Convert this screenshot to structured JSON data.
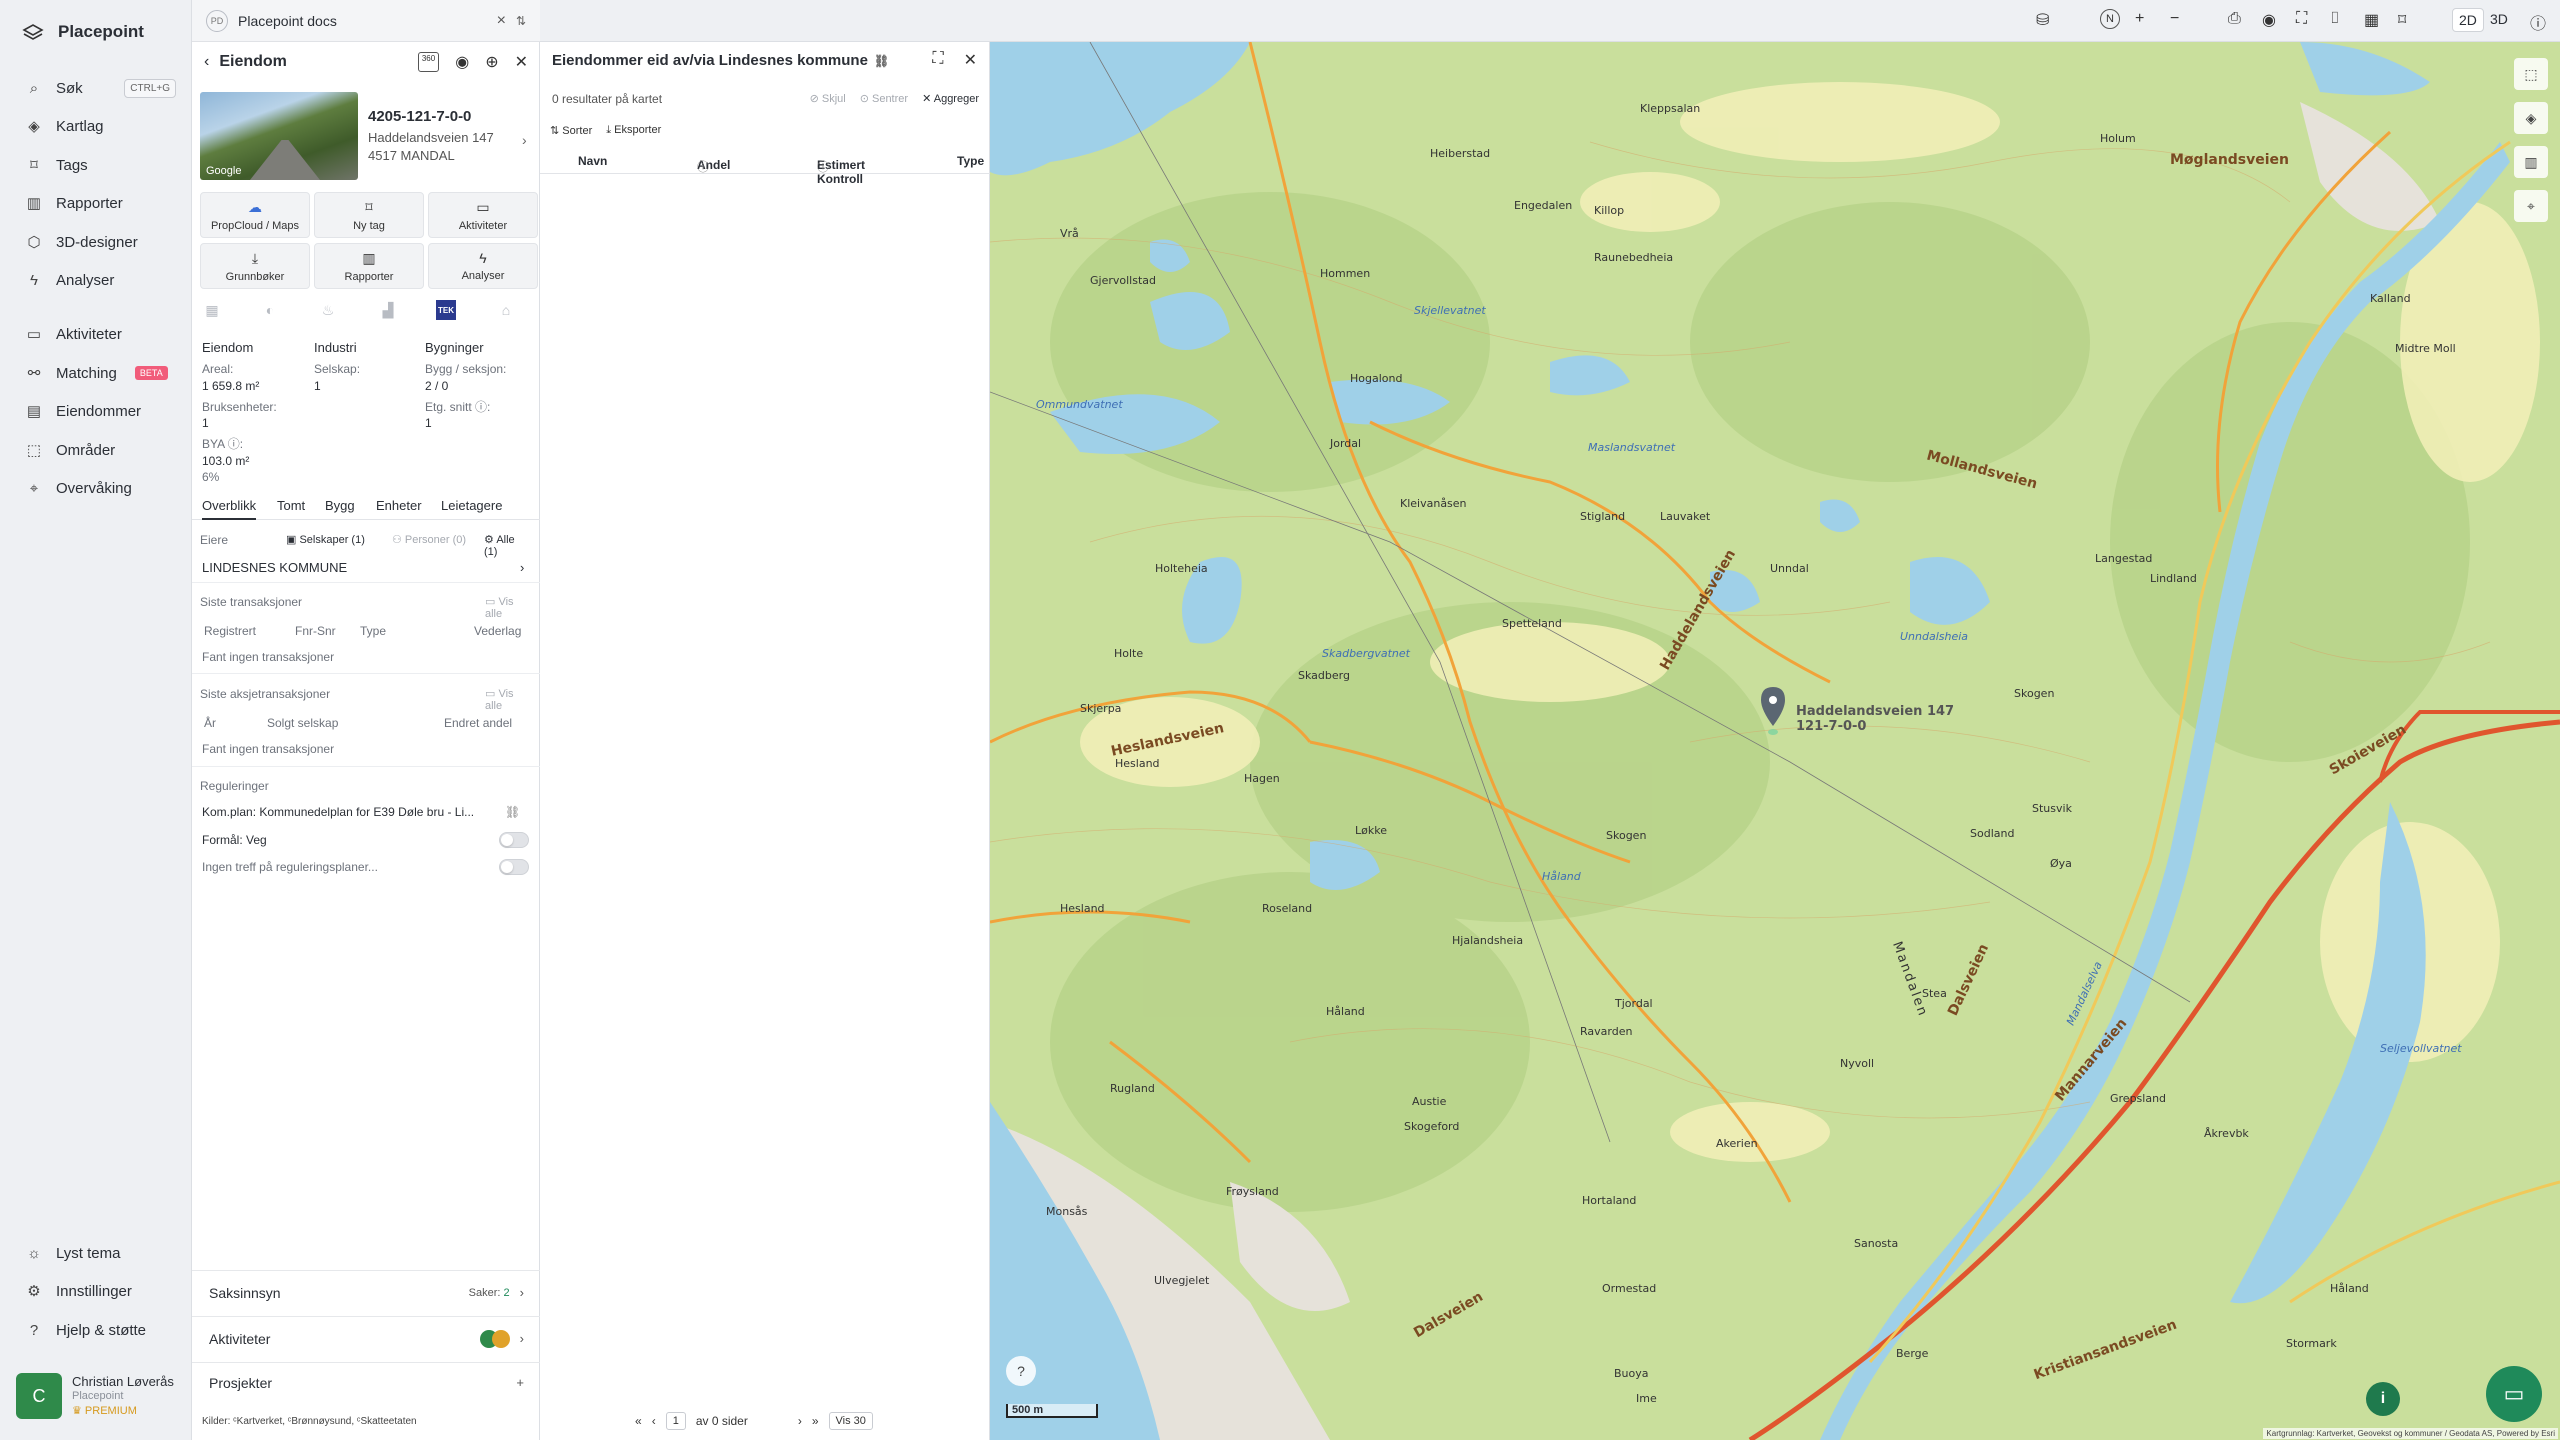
{
  "app": {
    "name": "Placepoint"
  },
  "nav": {
    "items": [
      {
        "label": "Søk",
        "shortcut": "CTRL+G"
      },
      {
        "label": "Kartlag"
      },
      {
        "label": "Tags"
      },
      {
        "label": "Rapporter"
      },
      {
        "label": "3D-designer"
      },
      {
        "label": "Analyser"
      },
      {
        "label": "Aktiviteter"
      },
      {
        "label": "Matching",
        "badge": "BETA"
      },
      {
        "label": "Eiendommer"
      },
      {
        "label": "Områder"
      },
      {
        "label": "Overvåking"
      }
    ],
    "bottom": [
      {
        "label": "Lyst tema"
      },
      {
        "label": "Innstillinger"
      },
      {
        "label": "Hjelp & støtte"
      }
    ],
    "user": {
      "initial": "C",
      "name": "Christian Løverås",
      "org": "Placepoint",
      "plan": "PREMIUM"
    }
  },
  "docs": {
    "badge": "PD",
    "title": "Placepoint docs"
  },
  "property": {
    "header": "Eiendom",
    "badge360": "360",
    "photo_credit": "Google",
    "id": "4205-121-7-0-0",
    "address": "Haddelandsveien 147",
    "postal": "4517 MANDAL",
    "actions": [
      {
        "label": "PropCloud / Maps",
        "icon": "cloud-icon"
      },
      {
        "label": "Ny tag",
        "icon": "bookmark-icon"
      },
      {
        "label": "Aktiviteter",
        "icon": "chat-icon"
      },
      {
        "label": "Grunnbøker",
        "icon": "download-icon"
      },
      {
        "label": "Rapporter",
        "icon": "chart-icon"
      },
      {
        "label": "Analyser",
        "icon": "bolt-icon"
      }
    ],
    "tek_label": "TEK",
    "stats": {
      "col1_header": "Eiendom",
      "col2_header": "Industri",
      "col3_header": "Bygninger",
      "areal_label": "Areal:",
      "areal_value": "1 659.8 m²",
      "bruksenheter_label": "Bruksenheter:",
      "bruksenheter_value": "1",
      "bya_label": "BYA ⓘ:",
      "bya_value": "103.0 m²",
      "bya_pct": "6%",
      "selskap_label": "Selskap:",
      "selskap_value": "1",
      "bygg_label": "Bygg / seksjon:",
      "bygg_value": "2 / 0",
      "etg_label": "Etg. snitt ⓘ:",
      "etg_value": "1"
    },
    "tabs": [
      "Overblikk",
      "Tomt",
      "Bygg",
      "Enheter",
      "Leietagere"
    ],
    "owners": {
      "label": "Eiere",
      "filter_companies": "Selskaper (1)",
      "filter_persons": "Personer (0)",
      "filter_all": "Alle (1)",
      "owner_name": "LINDESNES KOMMUNE"
    },
    "transactions": {
      "title": "Siste transaksjoner",
      "see_all": "Vis alle",
      "cols": [
        "Registrert",
        "Fnr-Snr",
        "Type",
        "Vederlag"
      ],
      "empty": "Fant ingen transaksjoner"
    },
    "share_transactions": {
      "title": "Siste aksjetransaksjoner",
      "see_all": "Vis alle",
      "cols": [
        "År",
        "Solgt selskap",
        "Endret andel"
      ],
      "empty": "Fant ingen transaksjoner"
    },
    "regulations": {
      "title": "Reguleringer",
      "plan": "Kom.plan: Kommunedelplan for E39 Døle bru - Li...",
      "purpose": "Formål: Veg",
      "no_hits": "Ingen treff på reguleringsplaner..."
    },
    "bottom_rows": {
      "saksinnsyn": "Saksinnsyn",
      "saker_label": "Saker:",
      "saker_count": "2",
      "aktiviteter": "Aktiviteter",
      "prosjekter": "Prosjekter"
    },
    "sources": "Kilder: ᶜKartverket, ᶜBrønnøysund, ᶜSkatteetaten"
  },
  "ownership_panel": {
    "title": "Eiendommer eid av/via Lindesnes kommune",
    "count": "0 resultater på kartet",
    "hide": "Skjul",
    "center": "Sentrer",
    "aggregate": "Aggreger",
    "sort": "Sorter",
    "export": "Eksporter",
    "columns": [
      "Navn",
      "Andel",
      "Estimert Kontroll",
      "Type"
    ],
    "pager": {
      "page": "1",
      "of_label": "av 0 sider",
      "per_page": "Vis 30"
    }
  },
  "map": {
    "modes": [
      "2D",
      "3D"
    ],
    "scale": "500 m",
    "attribution": "Kartgrunnlag: Kartverket, Geovekst og kommuner / Geodata AS, Powered by Esri",
    "marker_label_1": "Haddelandsveien 147",
    "marker_label_2": "121-7-0-0",
    "place_labels": [
      "Møglandsveien",
      "Holum",
      "Kleppsalan",
      "Heiberstad",
      "Engedalen",
      "Killop",
      "Raunebedheia",
      "Hommen",
      "Gjervollstad",
      "Vrå",
      "Kalland",
      "Midtre Moll",
      "Mollandsveien",
      "Hogalond",
      "Jordal",
      "Kleivanåsen",
      "Stigland",
      "Lauvaket",
      "Holteheia",
      "Haddelandsveien",
      "Spetteland",
      "Unndal",
      "Langestad",
      "Lindland",
      "Holte",
      "Skadberg",
      "Skjerpa",
      "Heslandsveien",
      "Hesland",
      "Hagen",
      "Løkke",
      "Skogen",
      "Sodland",
      "Stusvik",
      "Øya",
      "Mandalen",
      "Dalsveien",
      "Hesland",
      "Roseland",
      "Hjalandsheia",
      "Tjordal",
      "Stea",
      "Håland",
      "Ravarden",
      "Mannarveien",
      "Grepsland",
      "Rugland",
      "Austie",
      "Skogeford",
      "Nyvoll",
      "Åkrevbk",
      "Akerien",
      "Frøysland",
      "Monsås",
      "Ulvegjelet",
      "Hortaland",
      "Ormestad",
      "Sanosta",
      "Håland",
      "Kristiansandsveien",
      "Ime",
      "Berge",
      "Buoya",
      "Stormark",
      "Dalsveien",
      "Skoieveien",
      "Skogen"
    ],
    "water_labels": [
      "Skjellevatnet",
      "Ommundvatnet",
      "Maslandsvatnet",
      "Skadbergvatnet",
      "Unndalsheia",
      "Håland",
      "Seljevollvatnet",
      "Mandalselva"
    ],
    "colors": {
      "land": "#c9df9c",
      "forest_dark": "#b6d38a",
      "water": "#9fd0e8",
      "road_major": "#e0552e",
      "road_minor": "#f1a33a",
      "urban": "#e7e3dc",
      "marker": "#5b6672"
    }
  },
  "colors": {
    "accent": "#1f8a5a",
    "beta": "#f15c7a",
    "premium": "#d69a1e"
  }
}
